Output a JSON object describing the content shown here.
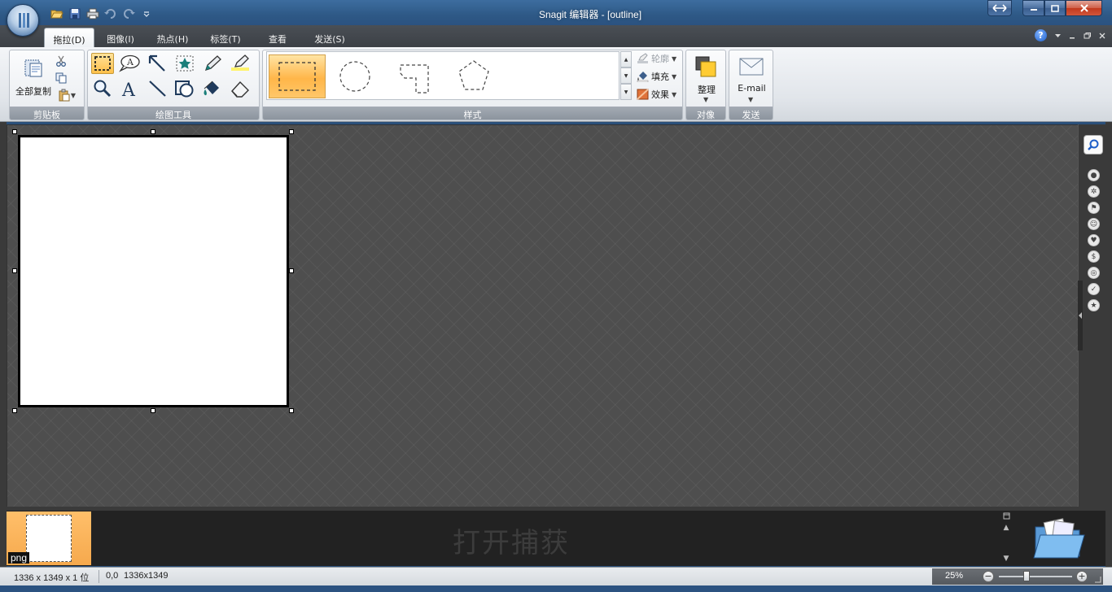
{
  "window": {
    "title": "Snagit 编辑器 - [outline]"
  },
  "tabs": [
    {
      "label": "拖拉(D)",
      "active": true
    },
    {
      "label": "图像(I)",
      "active": false
    },
    {
      "label": "热点(H)",
      "active": false
    },
    {
      "label": "标签(T)",
      "active": false
    },
    {
      "label": "查看(V)",
      "active": false
    },
    {
      "label": "发送(S)",
      "active": false
    }
  ],
  "ribbon": {
    "clipboard": {
      "copy_all_label": "全部复制",
      "group_label": "剪贴板"
    },
    "drawing_tools": {
      "group_label": "绘图工具",
      "text_tool_glyph": "A",
      "callout_glyph": "A",
      "tools": [
        "selection-tool",
        "callout-tool",
        "arrow-tool",
        "stamp-tool",
        "pen-tool",
        "highlighter-tool",
        "zoom-tool",
        "text-tool",
        "line-tool",
        "shape-tool",
        "fill-tool",
        "eraser-tool"
      ],
      "selected_tool": "selection-tool"
    },
    "styles": {
      "group_label": "样式",
      "outline_label": "轮廓",
      "fill_label": "填充",
      "effects_label": "效果",
      "gallery": [
        "rectangle-outline",
        "ellipse-outline",
        "freeform-outline",
        "polygon-outline"
      ],
      "selected": "rectangle-outline"
    },
    "object": {
      "arrange_label": "整理",
      "group_label": "对像"
    },
    "send": {
      "email_label": "E-mail",
      "group_label": "发送"
    }
  },
  "tray": {
    "thumb_label": "png",
    "hint": "打开捕获"
  },
  "status": {
    "image_info": "1336 x 1349 x 1 位",
    "position": "0,0",
    "size": "1336x1349",
    "zoom": "25%",
    "zoom_value_percent": 25
  },
  "colors": {
    "canvas_bg": "#4e4e4e",
    "selection_accent": "#ffc04a",
    "title_bar": "#2e5986"
  }
}
